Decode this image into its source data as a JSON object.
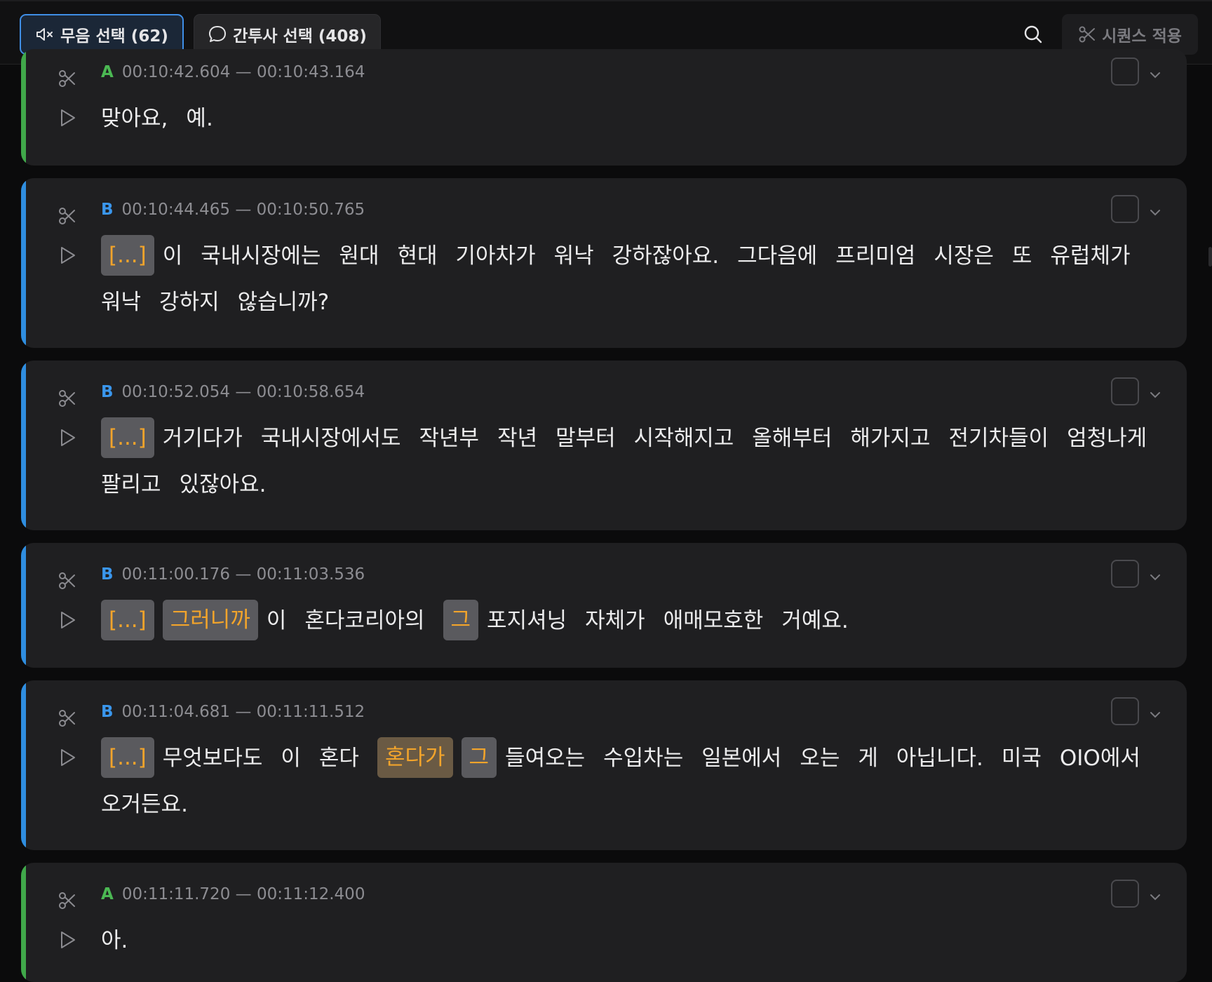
{
  "toolbar": {
    "silence_button": "무음 선택 (62)",
    "filler_button": "간투사 선택 (408)",
    "apply_button": "시퀀스 적용",
    "icons": [
      "mute-icon",
      "speech-bubble-icon",
      "search-icon",
      "scissors-icon"
    ]
  },
  "colors": {
    "speaker_a": "#40a84a",
    "speaker_b": "#2f8ee0",
    "filler_text": "#f2a42b",
    "active_button_border": "#3f8ee6"
  },
  "segments": [
    {
      "speaker": "A",
      "time": "00:10:42.604 — 00:10:43.164",
      "words": [
        {
          "t": "맞아요,"
        },
        {
          "t": "예."
        }
      ]
    },
    {
      "speaker": "B",
      "time": "00:10:44.465 — 00:10:50.765",
      "words": [
        {
          "t": "[...]",
          "chip": true
        },
        {
          "t": "이"
        },
        {
          "t": "국내시장에는"
        },
        {
          "t": "원대"
        },
        {
          "t": "현대"
        },
        {
          "t": "기아차가"
        },
        {
          "t": "워낙"
        },
        {
          "t": "강하잖아요."
        },
        {
          "t": "그다음에"
        },
        {
          "t": "프리미엄"
        },
        {
          "t": "시장은"
        },
        {
          "t": "또"
        },
        {
          "t": "유럽체가"
        },
        {
          "t": "워낙"
        },
        {
          "t": "강하지"
        },
        {
          "t": "않습니까?"
        }
      ]
    },
    {
      "speaker": "B",
      "time": "00:10:52.054 — 00:10:58.654",
      "words": [
        {
          "t": "[...]",
          "chip": true
        },
        {
          "t": "거기다가"
        },
        {
          "t": "국내시장에서도"
        },
        {
          "t": "작년부"
        },
        {
          "t": "작년"
        },
        {
          "t": "말부터"
        },
        {
          "t": "시작해지고"
        },
        {
          "t": "올해부터"
        },
        {
          "t": "해가지고"
        },
        {
          "t": "전기차들이"
        },
        {
          "t": "엄청나게"
        },
        {
          "t": "팔리고"
        },
        {
          "t": "있잖아요."
        }
      ]
    },
    {
      "speaker": "B",
      "time": "00:11:00.176 — 00:11:03.536",
      "words": [
        {
          "t": "[...]",
          "chip": true
        },
        {
          "t": "그러니까",
          "chip": true
        },
        {
          "t": "이"
        },
        {
          "t": "혼다코리아의"
        },
        {
          "t": "그",
          "chip": true
        },
        {
          "t": "포지셔닝"
        },
        {
          "t": "자체가"
        },
        {
          "t": "애매모호한"
        },
        {
          "t": "거예요."
        }
      ]
    },
    {
      "speaker": "B",
      "time": "00:11:04.681 — 00:11:11.512",
      "words": [
        {
          "t": "[...]",
          "chip": true
        },
        {
          "t": "무엇보다도"
        },
        {
          "t": "이"
        },
        {
          "t": "혼다"
        },
        {
          "t": "혼다가",
          "chip": true,
          "active": true
        },
        {
          "t": "그",
          "chip": true
        },
        {
          "t": "들여오는"
        },
        {
          "t": "수입차는"
        },
        {
          "t": "일본에서"
        },
        {
          "t": "오는"
        },
        {
          "t": "게"
        },
        {
          "t": "아닙니다."
        },
        {
          "t": "미국"
        },
        {
          "t": "OIO에서"
        },
        {
          "t": "오거든요."
        }
      ]
    },
    {
      "speaker": "A",
      "time": "00:11:11.720 — 00:11:12.400",
      "words": [
        {
          "t": "아."
        }
      ]
    }
  ]
}
